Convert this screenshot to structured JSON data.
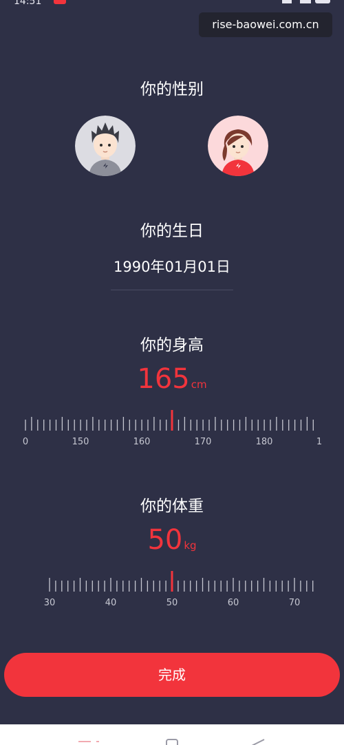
{
  "status_bar": {
    "time": "14:51"
  },
  "watermark": "rise-baowei.com.cn",
  "gender": {
    "title": "你的性别"
  },
  "birthday": {
    "title": "你的生日",
    "value": "1990年01月01日"
  },
  "height": {
    "title": "你的身高",
    "value": "165",
    "unit": "cm",
    "ruler_labels": [
      "0",
      "150",
      "160",
      "170",
      "180",
      "1"
    ]
  },
  "weight": {
    "title": "你的体重",
    "value": "50",
    "unit": "kg",
    "ruler_labels": [
      "30",
      "40",
      "50",
      "60",
      "70"
    ]
  },
  "done_label": "完成",
  "colors": {
    "accent": "#f2343c",
    "background": "#2e3046"
  },
  "icons": {
    "male_avatar": "male-avatar-icon",
    "female_avatar": "female-avatar-icon",
    "nav_menu": "menu-icon",
    "nav_home": "home-icon",
    "nav_back": "back-icon"
  }
}
